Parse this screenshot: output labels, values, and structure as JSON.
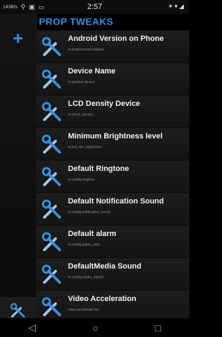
{
  "status": {
    "speed": "1438/s",
    "time": "2:57"
  },
  "header": {
    "title": "PROP TWEAKS"
  },
  "list": [
    {
      "name": "Android Version on Phone",
      "prop": "ro.build.version.release"
    },
    {
      "name": "Device Name",
      "prop": "ro.product.device"
    },
    {
      "name": "LCD Density Device",
      "prop": "ro.sf.lcd_density"
    },
    {
      "name": "Minimum Brightness level",
      "prop": "ro.lcd_min_brightness"
    },
    {
      "name": "Default Ringtone",
      "prop": "ro.config.ringtone"
    },
    {
      "name": "Default Notification Sound",
      "prop": "ro.config.notification_sound"
    },
    {
      "name": "Default alarm",
      "prop": "ro.config.alarm_alert"
    },
    {
      "name": "DefaultMedia Sound",
      "prop": "ro.config.media_sound"
    },
    {
      "name": "Video Acceleration",
      "prop": "video.accelerate.hw"
    }
  ],
  "icons": {
    "plus": "plus-icon",
    "tools": "tools-icon",
    "nav_back": "back-icon",
    "nav_home": "home-icon",
    "nav_recents": "recents-icon"
  },
  "colors": {
    "accent": "#2f8fe0",
    "background": "#000000"
  }
}
